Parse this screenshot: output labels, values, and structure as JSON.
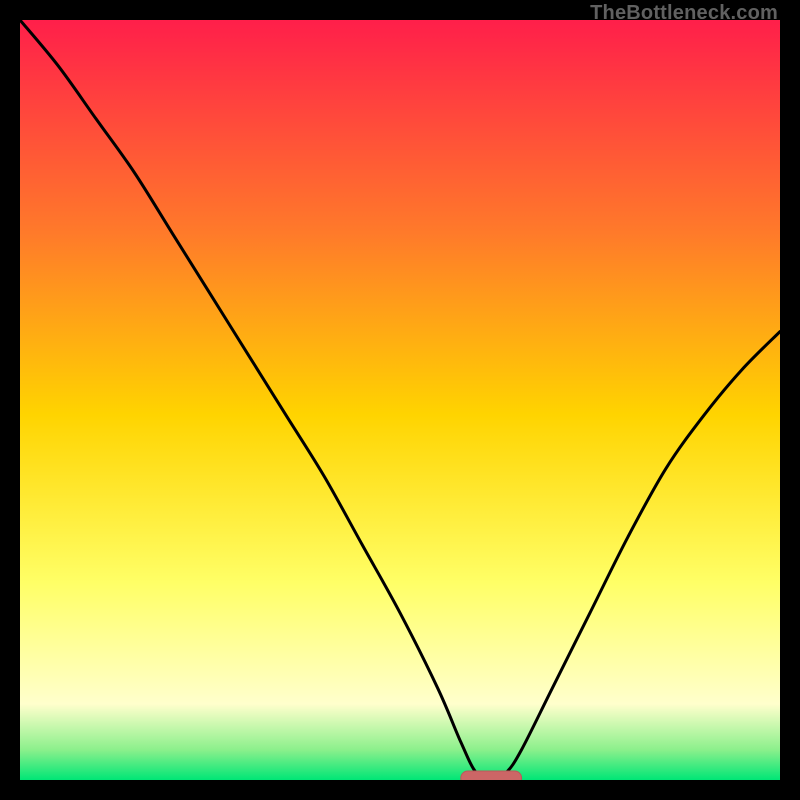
{
  "watermark": {
    "text": "TheBottleneck.com"
  },
  "colors": {
    "bg": "#000000",
    "curve": "#000000",
    "marker_fill": "#cc6666",
    "marker_stroke": "#b85a5a",
    "gradient": {
      "top": "#ff1f4a",
      "mid_upper": "#ff7a2a",
      "mid": "#ffd400",
      "mid_lower": "#ffff66",
      "pale": "#ffffcc",
      "green_light": "#8cf08c",
      "green": "#00e676"
    }
  },
  "chart_data": {
    "type": "line",
    "title": "",
    "xlabel": "",
    "ylabel": "",
    "xlim": [
      0,
      100
    ],
    "ylim": [
      0,
      100
    ],
    "x": [
      0,
      5,
      10,
      15,
      20,
      25,
      30,
      35,
      40,
      45,
      50,
      55,
      58,
      60,
      62,
      64,
      66,
      70,
      75,
      80,
      85,
      90,
      95,
      100
    ],
    "values": [
      100,
      94,
      87,
      80,
      72,
      64,
      56,
      48,
      40,
      31,
      22,
      12,
      5,
      1,
      0,
      1,
      4,
      12,
      22,
      32,
      41,
      48,
      54,
      59
    ],
    "minimum_marker": {
      "x_start": 58,
      "x_end": 66,
      "y": 0
    }
  }
}
